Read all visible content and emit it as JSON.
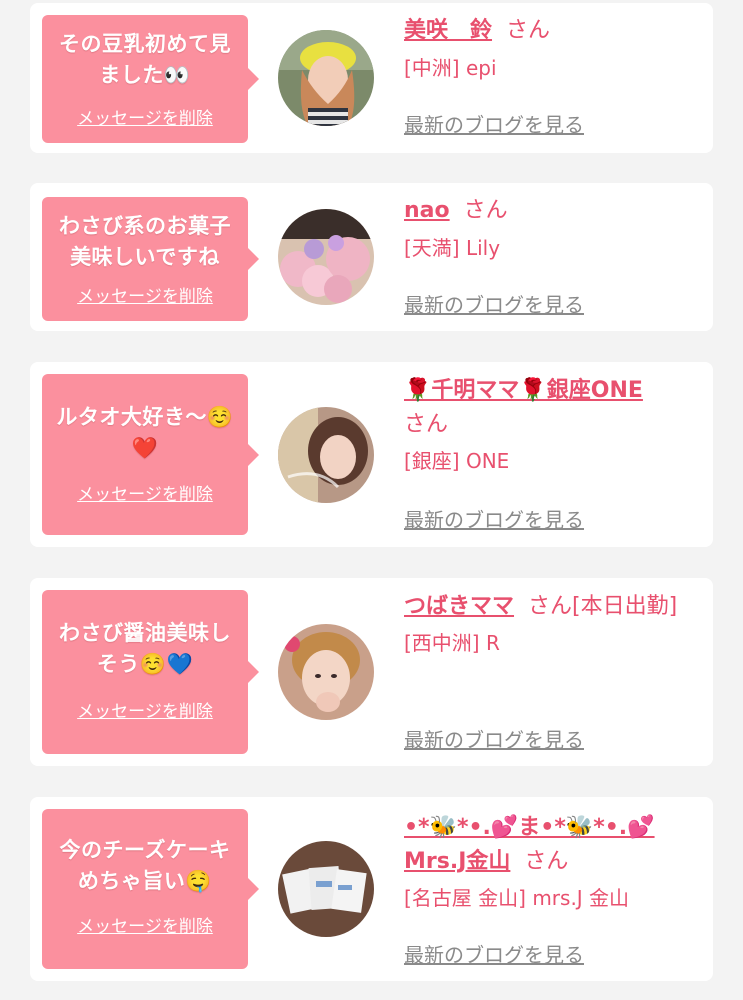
{
  "cards": [
    {
      "message": "その豆乳初めて見ました👀",
      "delete_label": "メッセージを削除",
      "name": "美咲　鈴",
      "honorific": "さん",
      "shop": "[中洲] epi",
      "blog_label": "最新のブログを見る",
      "avatar_icon": "woman-yellow-cap-photo"
    },
    {
      "message": "わさび系のお菓子美味しいですね",
      "delete_label": "メッセージを削除",
      "name": "nao",
      "honorific": "さん",
      "shop": "[天満] Lily",
      "blog_label": "最新のブログを見る",
      "avatar_icon": "pink-flowers-photo"
    },
    {
      "message": "ルタオ大好き〜☺️❤️",
      "delete_label": "メッセージを削除",
      "name": "🌹千明ママ🌹銀座ONE",
      "honorific": "さん",
      "shop": "[銀座] ONE",
      "blog_label": "最新のブログを見る",
      "avatar_icon": "woman-portrait-photo"
    },
    {
      "message": "わさび醤油美味しそう☺️💙",
      "delete_label": "メッセージを削除",
      "name": "つばきママ",
      "honorific": "さん[本日出勤]",
      "shop": "[西中洲] R",
      "blog_label": "最新のブログを見る",
      "avatar_icon": "woman-selfie-photo"
    },
    {
      "message": "今のチーズケーキめちゃ旨い🤤",
      "delete_label": "メッセージを削除",
      "name": "•*🐝*•.💕ま•*🐝*•.💕Mrs.J金山",
      "honorific": "さん",
      "shop": "[名古屋 金山] mrs.J 金山",
      "blog_label": "最新のブログを見る",
      "avatar_icon": "sweets-packages-photo"
    }
  ],
  "colors": {
    "bubble": "#fb909e",
    "accent": "#e8506e",
    "muted_link": "#8a8a8a",
    "background": "#f3f3f3",
    "card": "#ffffff"
  }
}
